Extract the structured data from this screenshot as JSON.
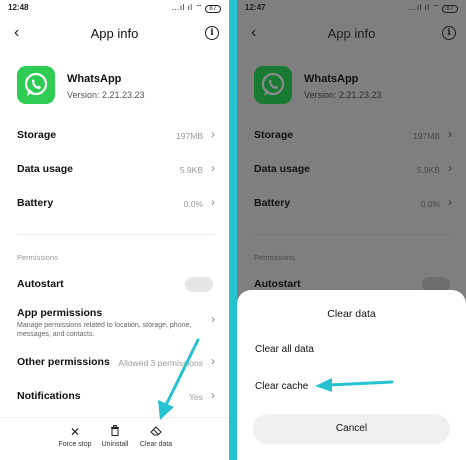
{
  "colors": {
    "divider_bg": "#27c2cf",
    "arrow": "#27c2cf",
    "whatsapp_green": "#2ecc52",
    "scrim": "#7f7f7f"
  },
  "left": {
    "status": {
      "time": "12:48",
      "battery": "87"
    },
    "header": {
      "title": "App info",
      "back_icon": "back-arrow-icon",
      "info_icon": "info-icon"
    },
    "app": {
      "name": "WhatsApp",
      "version": "Version: 2.21.23.23"
    },
    "rows": {
      "storage": {
        "label": "Storage",
        "value": "197MB"
      },
      "data_usage": {
        "label": "Data usage",
        "value": "5.9KB"
      },
      "battery": {
        "label": "Battery",
        "value": "0.0%"
      }
    },
    "permissions_section": "Permissions",
    "autostart": {
      "label": "Autostart"
    },
    "app_permissions": {
      "label": "App permissions",
      "desc": "Manage permissions related to location, storage, phone, messages, and contacts."
    },
    "other_permissions": {
      "label": "Other permissions",
      "value": "Allowed 3 permissions"
    },
    "notifications": {
      "label": "Notifications",
      "value": "Yes"
    },
    "actions": {
      "force_stop": "Force stop",
      "uninstall": "Uninstall",
      "clear_data": "Clear data"
    }
  },
  "right": {
    "status": {
      "time": "12:47",
      "battery": "87"
    },
    "header": {
      "title": "App info"
    },
    "app": {
      "name": "WhatsApp",
      "version": "Version: 2.21.23.23"
    },
    "rows": {
      "storage": {
        "label": "Storage",
        "value": "197MB"
      },
      "data_usage": {
        "label": "Data usage",
        "value": "5.9KB"
      },
      "battery": {
        "label": "Battery",
        "value": "0.0%"
      }
    },
    "permissions_section": "Permissions",
    "autostart": {
      "label": "Autostart"
    },
    "dialog": {
      "title": "Clear data",
      "clear_all": "Clear all data",
      "clear_cache": "Clear cache",
      "cancel": "Cancel"
    }
  }
}
